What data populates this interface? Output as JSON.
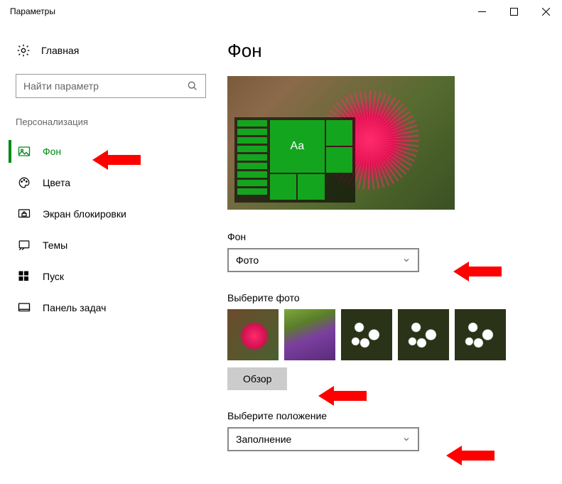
{
  "window": {
    "title": "Параметры"
  },
  "sidebar": {
    "home": "Главная",
    "search_placeholder": "Найти параметр",
    "section": "Персонализация",
    "items": [
      {
        "label": "Фон"
      },
      {
        "label": "Цвета"
      },
      {
        "label": "Экран блокировки"
      },
      {
        "label": "Темы"
      },
      {
        "label": "Пуск"
      },
      {
        "label": "Панель задач"
      }
    ]
  },
  "main": {
    "title": "Фон",
    "preview_tile_text": "Aa",
    "bg_label": "Фон",
    "bg_value": "Фото",
    "choose_photo_label": "Выберите фото",
    "browse": "Обзор",
    "fit_label": "Выберите положение",
    "fit_value": "Заполнение"
  }
}
